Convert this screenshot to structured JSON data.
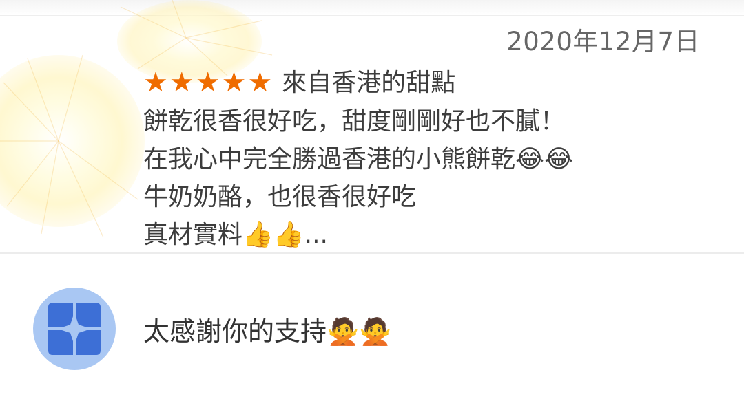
{
  "review": {
    "date": "2020年12月7日",
    "stars": "★★★★★",
    "rating": 5,
    "reviewer": "來自香港的甜點",
    "lines": [
      "餅乾很香很好吃，甜度剛剛好也不膩！",
      "在我心中完全勝過香港的小熊餅乾😂😂",
      "牛奶奶酪，也很香很好吃",
      "真材實料👍👍..."
    ]
  },
  "reply": {
    "text": "太感謝你的支持🙅🙅",
    "avatar_icon": "store-logo-icon"
  },
  "colors": {
    "star": "#ef6c00",
    "avatar_bg": "#a9c7f3",
    "avatar_fg": "#3d6fd6",
    "text": "#3d3d3d",
    "date": "#666666"
  }
}
